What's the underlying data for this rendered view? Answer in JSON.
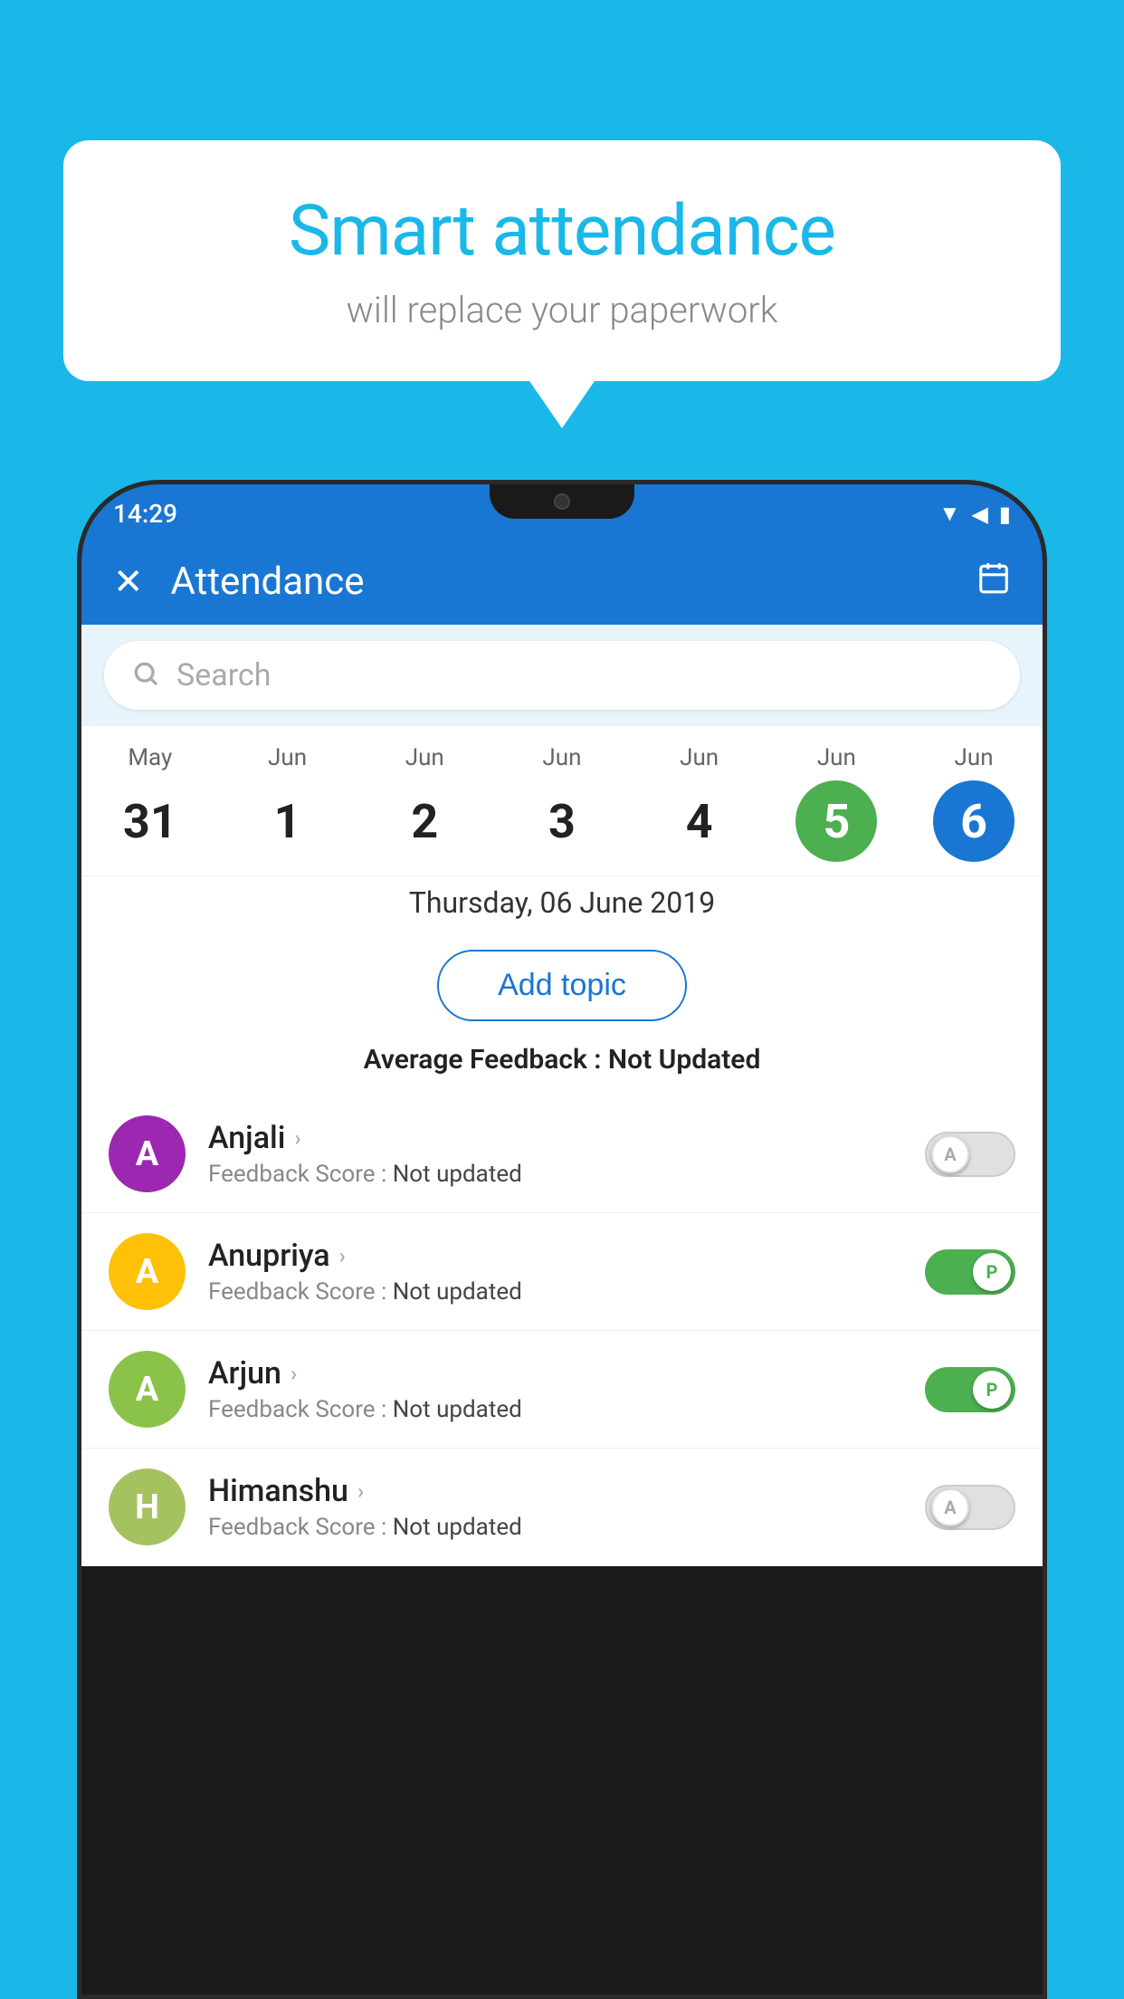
{
  "background_color": "#1ab8e8",
  "bubble": {
    "title": "Smart attendance",
    "subtitle": "will replace your paperwork"
  },
  "status_bar": {
    "time": "14:29",
    "wifi": "▼",
    "signal": "▲",
    "battery": "▮"
  },
  "header": {
    "title": "Attendance",
    "close_label": "✕",
    "calendar_icon": "📅"
  },
  "search": {
    "placeholder": "Search"
  },
  "calendar": {
    "days": [
      {
        "month": "May",
        "number": "31",
        "selected": ""
      },
      {
        "month": "Jun",
        "number": "1",
        "selected": ""
      },
      {
        "month": "Jun",
        "number": "2",
        "selected": ""
      },
      {
        "month": "Jun",
        "number": "3",
        "selected": ""
      },
      {
        "month": "Jun",
        "number": "4",
        "selected": ""
      },
      {
        "month": "Jun",
        "number": "5",
        "selected": "green"
      },
      {
        "month": "Jun",
        "number": "6",
        "selected": "blue"
      }
    ],
    "selected_date": "Thursday, 06 June 2019"
  },
  "add_topic": {
    "label": "Add topic"
  },
  "avg_feedback": {
    "label": "Average Feedback : ",
    "value": "Not Updated"
  },
  "students": [
    {
      "name": "Anjali",
      "avatar_letter": "A",
      "avatar_color": "purple",
      "feedback_label": "Feedback Score : ",
      "feedback_value": "Not updated",
      "toggle": "off",
      "toggle_letter": "A"
    },
    {
      "name": "Anupriya",
      "avatar_letter": "A",
      "avatar_color": "yellow",
      "feedback_label": "Feedback Score : ",
      "feedback_value": "Not updated",
      "toggle": "on",
      "toggle_letter": "P"
    },
    {
      "name": "Arjun",
      "avatar_letter": "A",
      "avatar_color": "green-light",
      "feedback_label": "Feedback Score : ",
      "feedback_value": "Not updated",
      "toggle": "on",
      "toggle_letter": "P"
    },
    {
      "name": "Himanshu",
      "avatar_letter": "H",
      "avatar_color": "olive",
      "feedback_label": "Feedback Score : ",
      "feedback_value": "Not updated",
      "toggle": "off",
      "toggle_letter": "A"
    }
  ]
}
